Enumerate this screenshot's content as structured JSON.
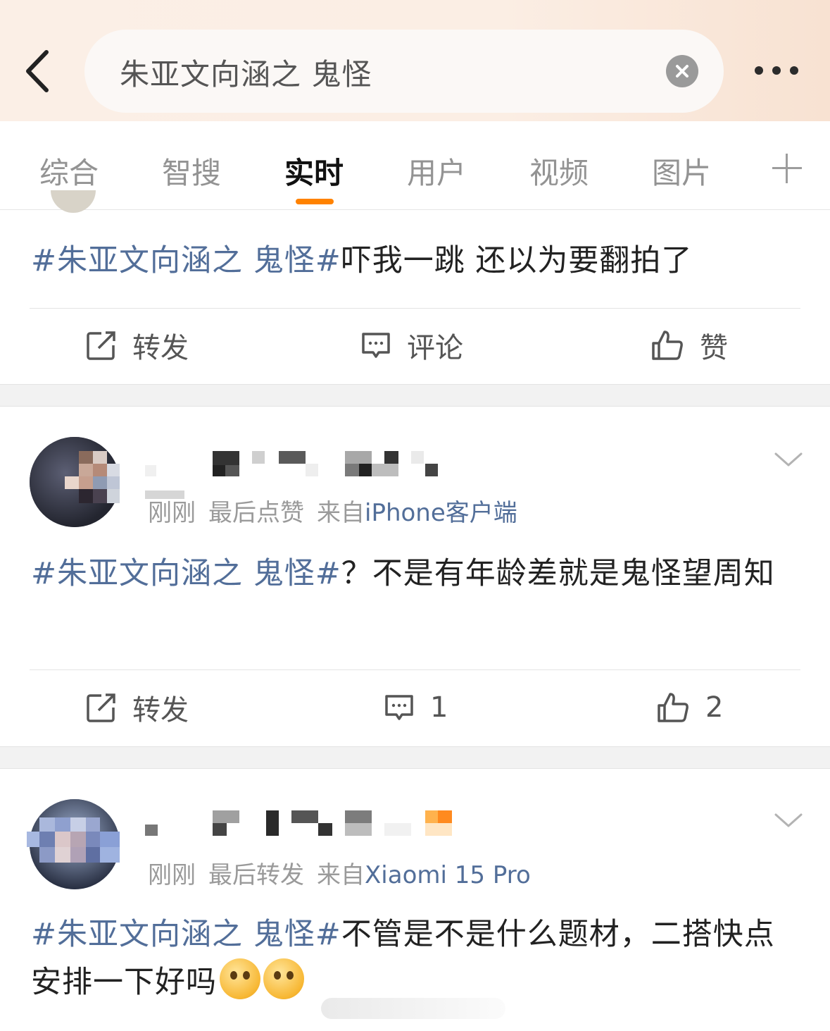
{
  "header": {
    "search_query": "朱亚文向涵之 鬼怪",
    "back_icon": "chevron-left-icon",
    "clear_icon": "close-circle-icon",
    "more_icon": "more-dots-icon"
  },
  "tabs": [
    {
      "label": "综合",
      "active": false
    },
    {
      "label": "智搜",
      "active": false
    },
    {
      "label": "实时",
      "active": true
    },
    {
      "label": "用户",
      "active": false
    },
    {
      "label": "视频",
      "active": false
    },
    {
      "label": "图片",
      "active": false
    }
  ],
  "colors": {
    "accent": "#ff8200",
    "hashtag": "#526e99",
    "band": "#f2f2f2"
  },
  "posts": [
    {
      "hashtag": "#朱亚文向涵之 鬼怪#",
      "text": "吓我一跳 还以为要翻拍了",
      "actions": {
        "repost": "转发",
        "comment": "评论",
        "like": "赞"
      }
    },
    {
      "time": "刚刚",
      "interaction": "最后点赞",
      "from": "来自",
      "source": "iPhone客户端",
      "hashtag": "#朱亚文向涵之 鬼怪#",
      "text": "？不是有年龄差就是鬼怪望周知",
      "actions": {
        "repost": "转发",
        "comment": "1",
        "like": "2"
      }
    },
    {
      "time": "刚刚",
      "interaction": "最后转发",
      "from": "来自",
      "source": "Xiaomi 15 Pro",
      "hashtag": "#朱亚文向涵之 鬼怪#",
      "text": "不管是不是什么题材，二搭快点安排一下好吗",
      "emoji": [
        "crying-covering-mouth-emoji",
        "crying-covering-mouth-emoji"
      ]
    }
  ]
}
